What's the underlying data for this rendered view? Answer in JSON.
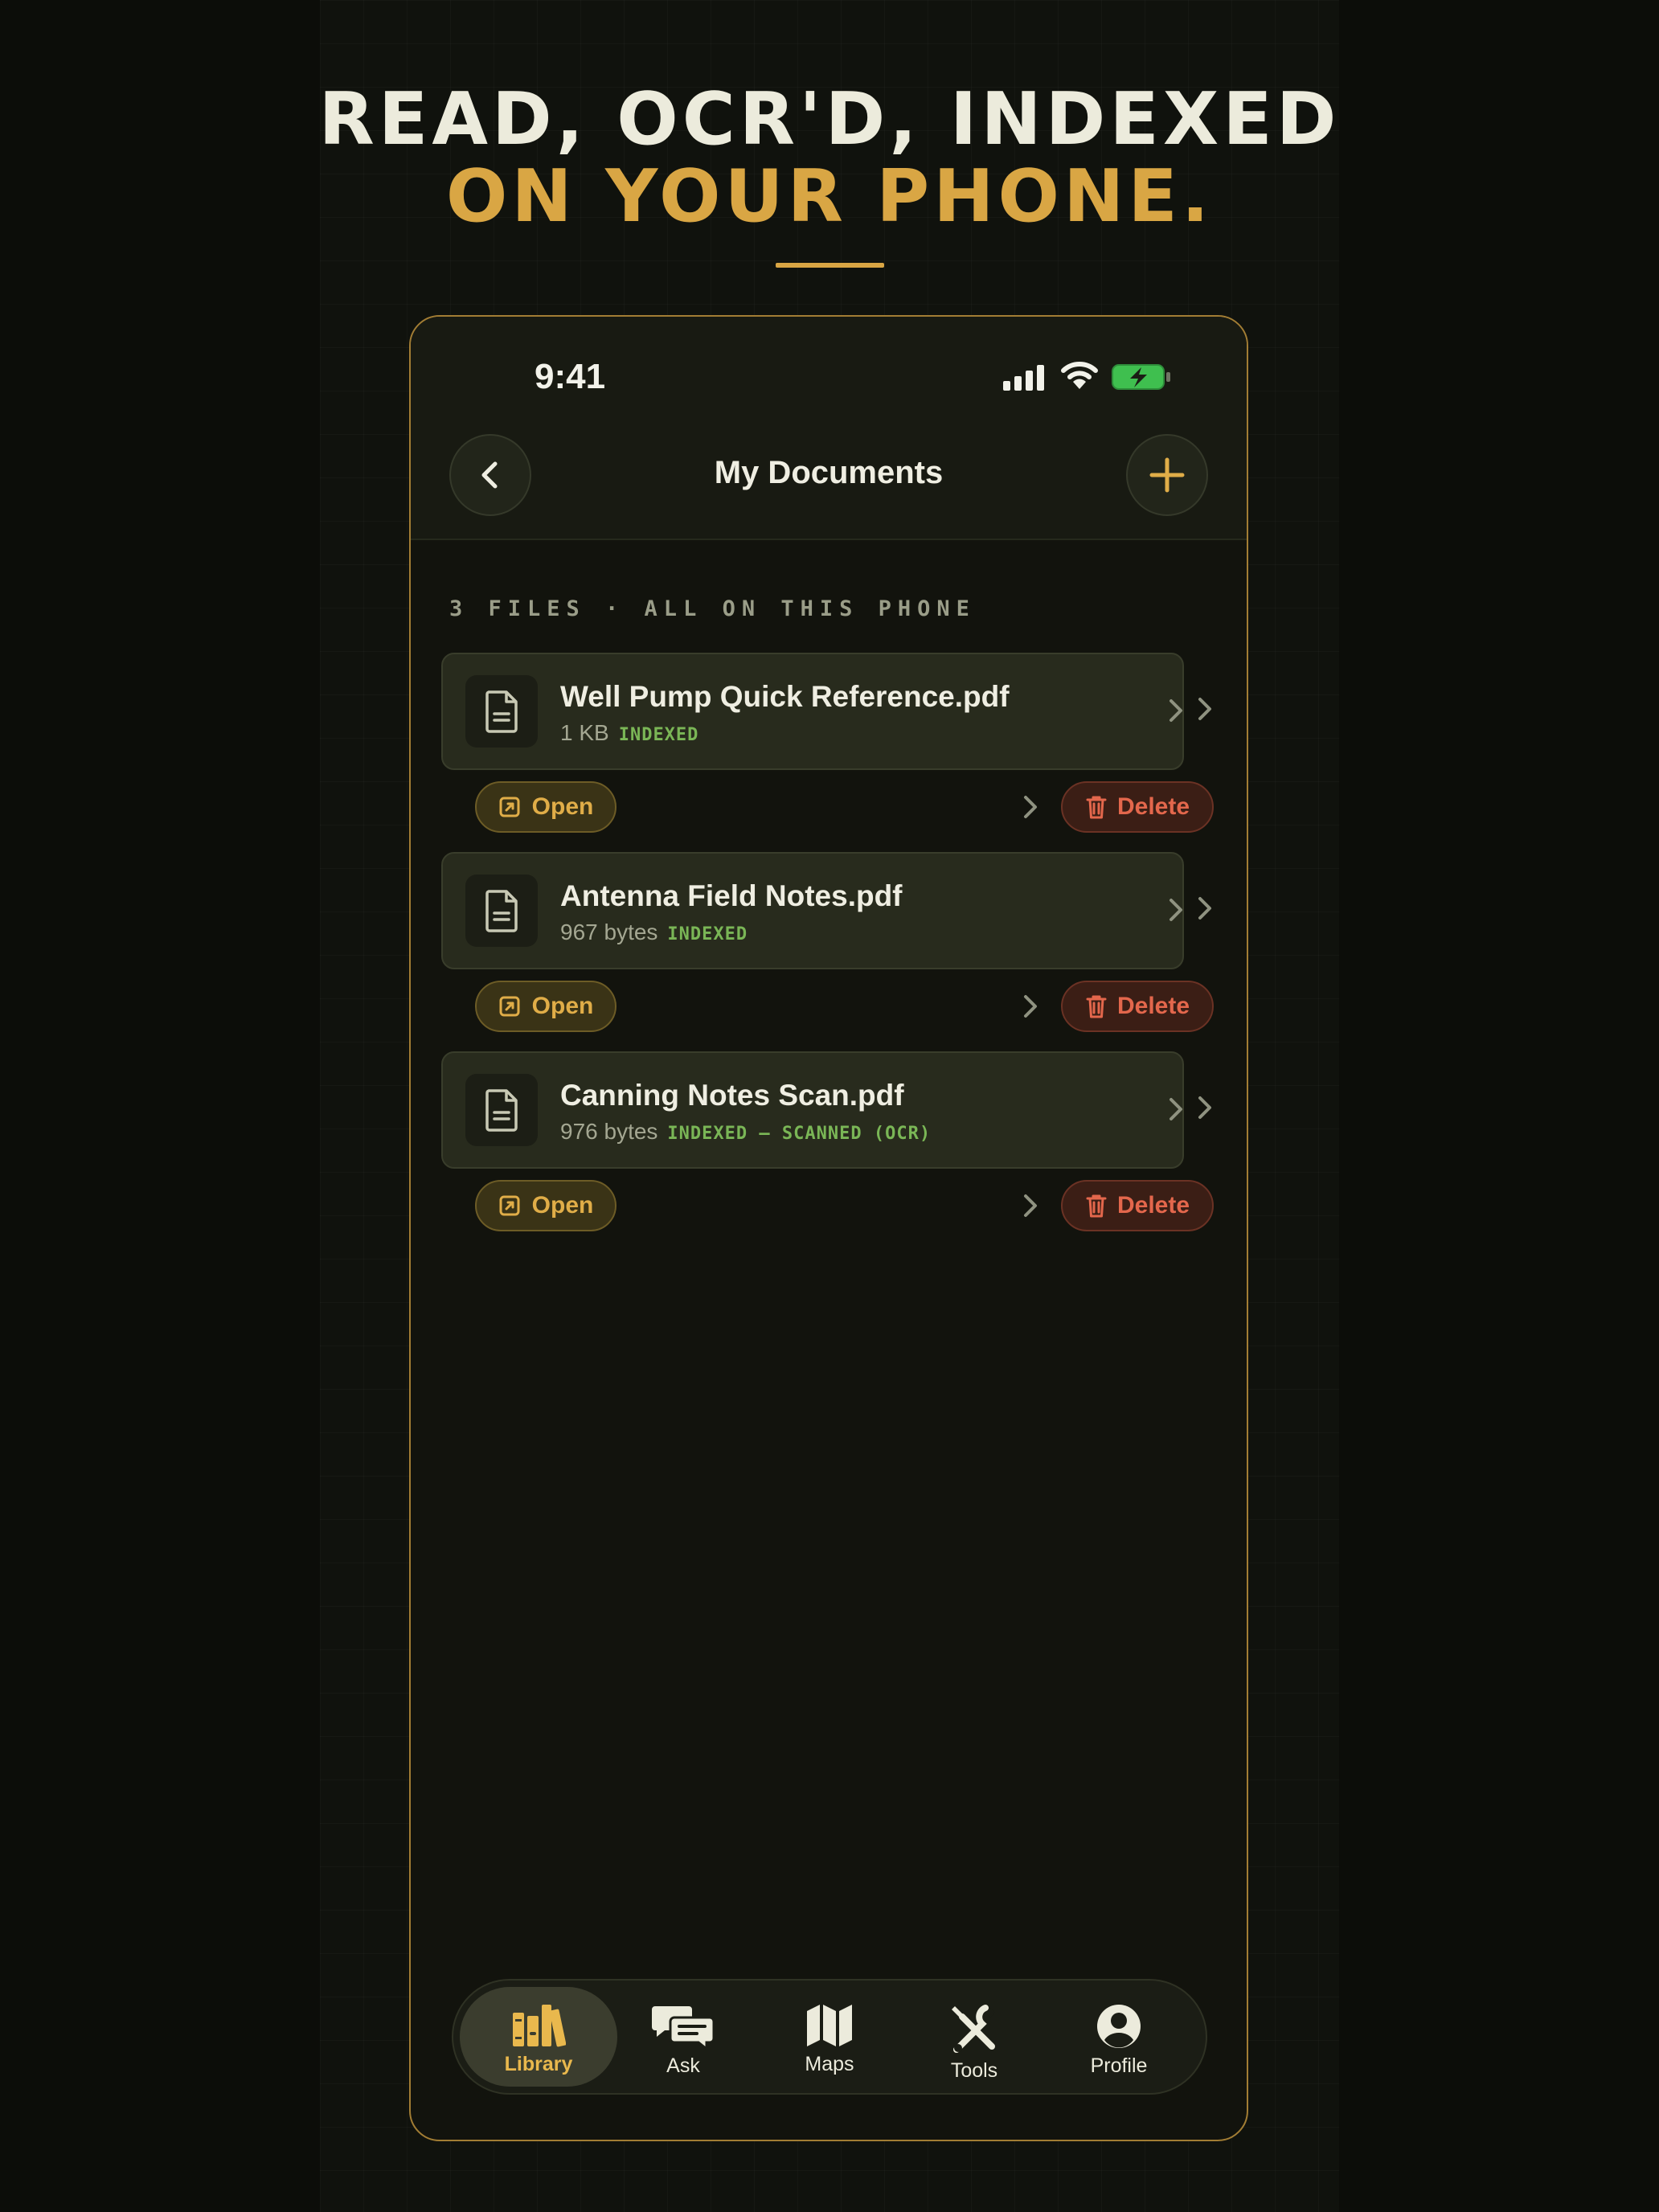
{
  "headline": {
    "line1": "READ, OCR'D, INDEXED",
    "line2": "ON YOUR PHONE."
  },
  "status_bar": {
    "time": "9:41"
  },
  "nav": {
    "title": "My Documents"
  },
  "section_label": "3 FILES · ALL ON THIS PHONE",
  "files": [
    {
      "name": "Well Pump Quick Reference.pdf",
      "size": "1 KB",
      "status": "INDEXED"
    },
    {
      "name": "Antenna Field Notes.pdf",
      "size": "967 bytes",
      "status": "INDEXED"
    },
    {
      "name": "Canning Notes Scan.pdf",
      "size": "976 bytes",
      "status": "INDEXED — SCANNED (OCR)"
    }
  ],
  "actions": {
    "open_label": "Open",
    "delete_label": "Delete"
  },
  "tabs": [
    {
      "label": "Library",
      "icon": "library-icon",
      "active": true
    },
    {
      "label": "Ask",
      "icon": "chat-bubbles-icon",
      "active": false
    },
    {
      "label": "Maps",
      "icon": "map-icon",
      "active": false
    },
    {
      "label": "Tools",
      "icon": "tools-icon",
      "active": false
    },
    {
      "label": "Profile",
      "icon": "profile-icon",
      "active": false
    }
  ],
  "colors": {
    "accent": "#d9a644",
    "indexed_green": "#7ab656",
    "delete_red": "#e3674c",
    "battery_green": "#3fbf4f"
  }
}
